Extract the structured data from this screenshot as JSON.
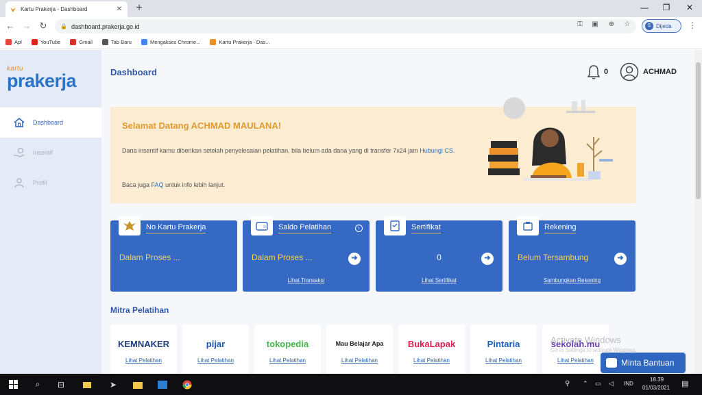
{
  "browser": {
    "tab_title": "Kartu Prakerja - Dashboard",
    "tab_close": "✕",
    "new_tab": "+",
    "window_controls": [
      "—",
      "❐",
      "✕"
    ],
    "url": "dashboard.prakerja.go.id",
    "profile_name": "Dijeda",
    "profile_initial": "S",
    "bookmarks": [
      {
        "label": "Apl",
        "icon": "apps-icon",
        "color": "#e8453c"
      },
      {
        "label": "YouTube",
        "icon": "youtube-icon",
        "color": "#e62117"
      },
      {
        "label": "Gmail",
        "icon": "gmail-icon",
        "color": "#d93025"
      },
      {
        "label": "Tab Baru",
        "icon": "globe-icon",
        "color": "#555555"
      },
      {
        "label": "Mengakses Chrome...",
        "icon": "google-icon",
        "color": "#4285f4"
      },
      {
        "label": "Kartu Prakerja - Das...",
        "icon": "prakerja-icon",
        "color": "#e98f2b"
      }
    ]
  },
  "sidebar": {
    "logo_small": "kartu",
    "logo_big": "prakerja",
    "items": [
      {
        "label": "Dashboard",
        "icon": "home-icon",
        "active": true
      },
      {
        "label": "Insentif",
        "icon": "hand-coin-icon",
        "active": false
      },
      {
        "label": "Profil",
        "icon": "profile-icon",
        "active": false
      }
    ]
  },
  "header": {
    "title": "Dashboard",
    "notif_count": "0",
    "user_name": "ACHMAD"
  },
  "welcome": {
    "title": "Selamat Datang ACHMAD MAULANA!",
    "text": "Dana insentif kamu diberikan setelah penyelesaian pelatihan, bila belum ada dana yang di transfer 7x24 jam",
    "link": "Hubungi CS",
    "link_end": ".",
    "foot_pre": "Baca juga",
    "foot_link": "FAQ",
    "foot_post": "untuk info lebih lanjut."
  },
  "cards": [
    {
      "title": "No Kartu Prakerja",
      "value": "Dalam Proses ...",
      "link": "",
      "icon": "garuda-icon",
      "info": false,
      "arrow": false
    },
    {
      "title": "Saldo Pelatihan",
      "value": "Dalam Proses ...",
      "link": "Lihat Transaksi",
      "icon": "wallet-icon",
      "info": true,
      "arrow": true
    },
    {
      "title": "Sertifikat",
      "value": "0",
      "link": "Lihat Sertifikat",
      "icon": "certificate-icon",
      "info": false,
      "arrow": true
    },
    {
      "title": "Rekening",
      "value": "Belum Tersambung",
      "link": "Sambungkan Rekening",
      "icon": "bank-icon",
      "info": false,
      "arrow": true
    }
  ],
  "card_arrow": "➜",
  "card_info": "i",
  "mitra": {
    "title": "Mitra Pelatihan",
    "partners": [
      {
        "name": "KEMNAKER",
        "link": "Lihat Pelatihan",
        "color": "#1f3d7a"
      },
      {
        "name": "pijar",
        "link": "Lihat Pelatihan",
        "color": "#1b58b8"
      },
      {
        "name": "tokopedia",
        "link": "Lihat Pelatihan",
        "color": "#42b549"
      },
      {
        "name": "Mau Belajar Apa",
        "link": "Lihat Pelatihan",
        "color": "#222222"
      },
      {
        "name": "BukaLapak",
        "link": "Lihat Pelatihan",
        "color": "#e31e52"
      },
      {
        "name": "Pintaria",
        "link": "Lihat Pelatihan",
        "color": "#1a5fb4"
      },
      {
        "name": "sekolah.mu",
        "link": "Lihat Pelatihan",
        "color": "#6a3fb0"
      }
    ]
  },
  "watermark": {
    "line1": "Activate Windows",
    "line2": "Go to Settings to activate Windows."
  },
  "help_button": "Minta Bantuan",
  "taskbar": {
    "lang": "IND",
    "time": "18.39",
    "date": "01/03/2021"
  },
  "colors": {
    "primary": "#3569c3",
    "accent": "#e09a2f",
    "banner_bg": "#fbecd2",
    "sidebar_bg": "#e4ebf6"
  }
}
